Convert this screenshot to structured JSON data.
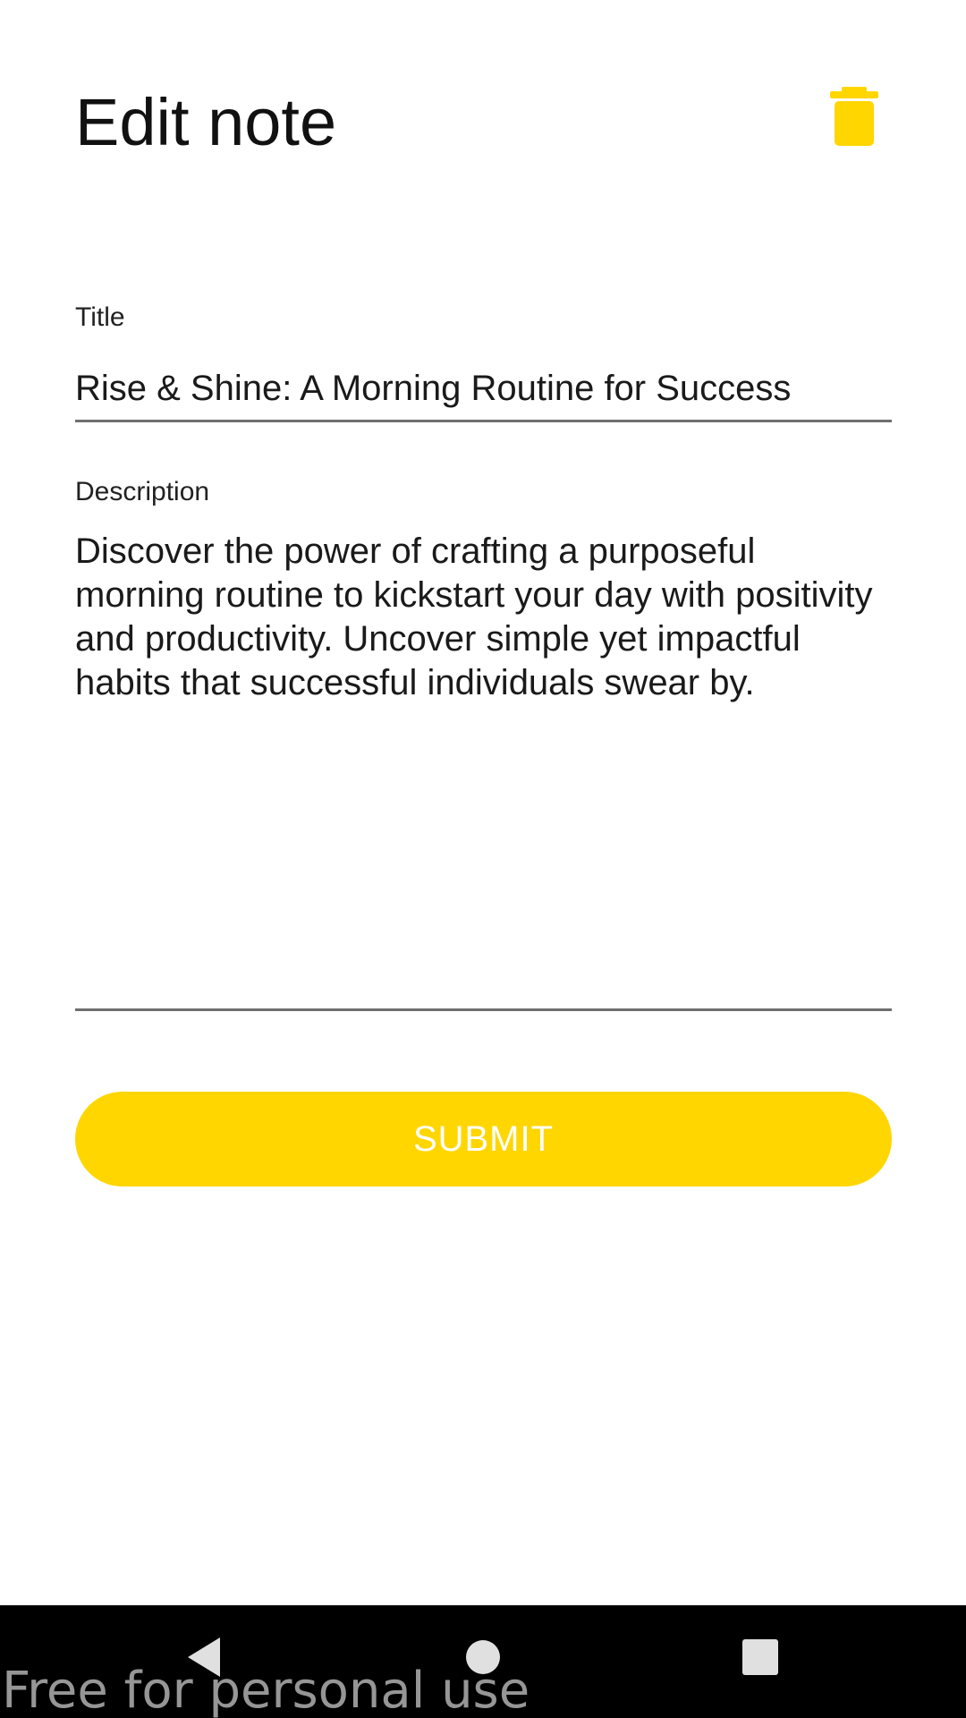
{
  "header": {
    "title": "Edit note",
    "delete_icon": "trash-icon",
    "accent_color": "#ffd600"
  },
  "form": {
    "title_label": "Title",
    "title_value": "Rise & Shine: A Morning Routine for Success",
    "description_label": "Description",
    "description_value": "Discover the power of crafting a purposeful morning routine to kickstart your day with positivity and productivity. Uncover simple yet impactful habits that successful individuals swear by.",
    "submit_label": "SUBMIT"
  },
  "navigation": {
    "back_icon": "back-triangle-icon",
    "home_icon": "home-circle-icon",
    "recents_icon": "recents-square-icon"
  },
  "watermark": {
    "text": "Free for personal use"
  }
}
